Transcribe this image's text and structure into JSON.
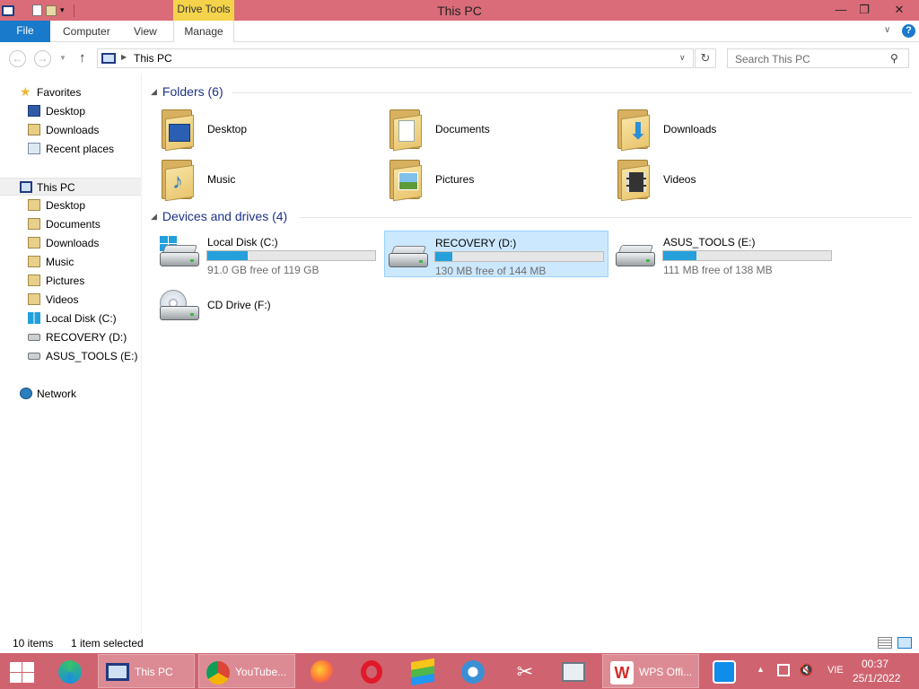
{
  "window": {
    "title": "This PC",
    "contextual_tab_group": "Drive Tools",
    "controls": {
      "minimize": "—",
      "maximize": "❐",
      "close": "✕"
    }
  },
  "ribbon": {
    "file": "File",
    "tabs": [
      "Computer",
      "View",
      "Manage"
    ],
    "help": "?"
  },
  "address_bar": {
    "path": "This PC",
    "search_placeholder": "Search This PC"
  },
  "navigation_pane": {
    "favorites": {
      "label": "Favorites",
      "items": [
        "Desktop",
        "Downloads",
        "Recent places"
      ]
    },
    "this_pc": {
      "label": "This PC",
      "selected": true,
      "items": [
        "Desktop",
        "Documents",
        "Downloads",
        "Music",
        "Pictures",
        "Videos",
        "Local Disk (C:)",
        "RECOVERY (D:)",
        "ASUS_TOOLS (E:)"
      ]
    },
    "network": {
      "label": "Network"
    }
  },
  "folders": {
    "header": "Folders (6)",
    "items": [
      {
        "name": "Desktop",
        "icon": "desktop-folder-icon"
      },
      {
        "name": "Documents",
        "icon": "documents-folder-icon"
      },
      {
        "name": "Downloads",
        "icon": "downloads-folder-icon"
      },
      {
        "name": "Music",
        "icon": "music-folder-icon"
      },
      {
        "name": "Pictures",
        "icon": "pictures-folder-icon"
      },
      {
        "name": "Videos",
        "icon": "videos-folder-icon"
      }
    ]
  },
  "drives": {
    "header": "Devices and drives (4)",
    "items": [
      {
        "name": "Local Disk (C:)",
        "free_text": "91.0 GB free of 119 GB",
        "used_fraction": 0.24,
        "selected": false
      },
      {
        "name": "RECOVERY (D:)",
        "free_text": "130 MB free of 144 MB",
        "used_fraction": 0.1,
        "selected": true
      },
      {
        "name": "ASUS_TOOLS (E:)",
        "free_text": "111 MB free of 138 MB",
        "used_fraction": 0.2,
        "selected": false
      },
      {
        "name": "CD Drive (F:)"
      }
    ]
  },
  "status_bar": {
    "item_count": "10 items",
    "selection": "1 item selected"
  },
  "taskbar": {
    "apps": [
      {
        "name": "edge",
        "label": ""
      },
      {
        "name": "this-pc",
        "label": "This PC"
      },
      {
        "name": "chrome",
        "label": "YouTube..."
      },
      {
        "name": "firefox",
        "label": ""
      },
      {
        "name": "opera",
        "label": ""
      },
      {
        "name": "bluestacks",
        "label": ""
      },
      {
        "name": "thunderbird",
        "label": ""
      },
      {
        "name": "snipping",
        "label": ""
      },
      {
        "name": "task-manager",
        "label": ""
      },
      {
        "name": "wps-office",
        "label": "WPS Offi..."
      },
      {
        "name": "teamviewer",
        "label": ""
      }
    ],
    "tray": {
      "language": "VIE",
      "time": "00:37",
      "date": "25/1/2022"
    }
  },
  "colors": {
    "titlebar": "#d96c78",
    "taskbar": "#cf6470",
    "accent": "#1979ca",
    "drive_bar": "#26a0da",
    "selection": "#cce8ff",
    "group_header": "#1e3287"
  }
}
